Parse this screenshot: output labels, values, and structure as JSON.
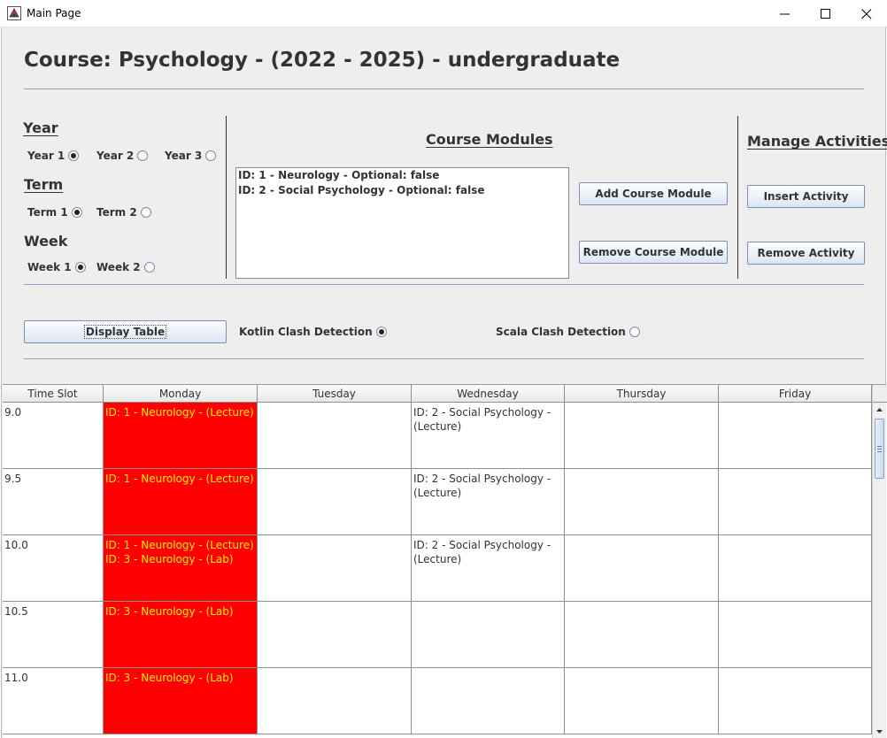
{
  "window": {
    "title": "Main Page",
    "icon": "java-cup-icon",
    "controls": [
      "minimize-icon",
      "maximize-icon",
      "close-icon"
    ]
  },
  "course_title": "Course: Psychology - (2022 - 2025) - undergraduate",
  "year": {
    "heading": "Year",
    "options": [
      {
        "label": "Year 1",
        "selected": true
      },
      {
        "label": "Year 2",
        "selected": false
      },
      {
        "label": "Year 3",
        "selected": false
      }
    ]
  },
  "term": {
    "heading": "Term",
    "options": [
      {
        "label": "Term 1",
        "selected": true
      },
      {
        "label": "Term 2",
        "selected": false
      }
    ]
  },
  "week": {
    "heading": "Week",
    "options": [
      {
        "label": "Week 1",
        "selected": true
      },
      {
        "label": "Week 2",
        "selected": false
      }
    ]
  },
  "course_modules": {
    "heading": "Course Modules",
    "items": [
      "ID: 1 - Neurology - Optional: false",
      "ID: 2 - Social Psychology - Optional: false"
    ],
    "add_label": "Add Course Module",
    "remove_label": "Remove Course Module"
  },
  "manage_activities": {
    "heading": "Manage Activities",
    "insert_label": "Insert Activity",
    "remove_label": "Remove Activity"
  },
  "controls": {
    "display_table_label": "Display Table",
    "kotlin_label": "Kotlin Clash Detection",
    "kotlin_selected": true,
    "scala_label": "Scala Clash Detection",
    "scala_selected": false
  },
  "colors": {
    "clash_background": "#ff0000",
    "clash_text": "#ffee00"
  },
  "timetable": {
    "columns": [
      "Time Slot",
      "Monday",
      "Tuesday",
      "Wednesday",
      "Thursday",
      "Friday"
    ],
    "rows": [
      {
        "slot": "9.0",
        "monday": [
          "ID: 1 - Neurology - (Lecture)"
        ],
        "monday_clash": true,
        "tuesday": [],
        "wednesday": [
          "ID: 2 - Social Psychology - (Lecture)"
        ],
        "thursday": [],
        "friday": []
      },
      {
        "slot": "9.5",
        "monday": [
          "ID: 1 - Neurology - (Lecture)"
        ],
        "monday_clash": true,
        "tuesday": [],
        "wednesday": [
          "ID: 2 - Social Psychology - (Lecture)"
        ],
        "thursday": [],
        "friday": []
      },
      {
        "slot": "10.0",
        "monday": [
          "ID: 1 - Neurology - (Lecture)",
          "ID: 3 - Neurology - (Lab)"
        ],
        "monday_clash": true,
        "tuesday": [],
        "wednesday": [
          "ID: 2 - Social Psychology - (Lecture)"
        ],
        "thursday": [],
        "friday": []
      },
      {
        "slot": "10.5",
        "monday": [
          "ID: 3 - Neurology - (Lab)"
        ],
        "monday_clash": true,
        "tuesday": [],
        "wednesday": [],
        "thursday": [],
        "friday": []
      },
      {
        "slot": "11.0",
        "monday": [
          "ID: 3 - Neurology - (Lab)"
        ],
        "monday_clash": true,
        "tuesday": [],
        "wednesday": [],
        "thursday": [],
        "friday": []
      }
    ]
  }
}
